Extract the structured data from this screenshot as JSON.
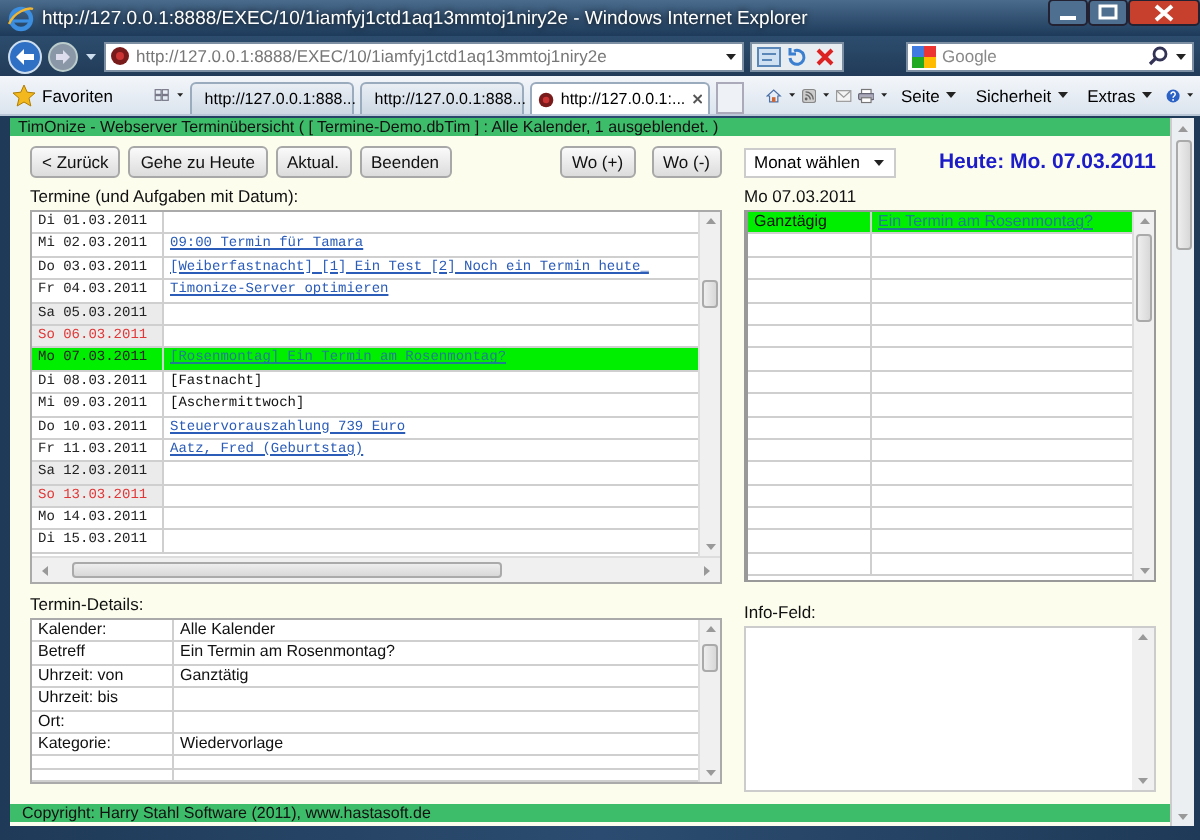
{
  "browser": {
    "title": "http://127.0.0.1:8888/EXEC/10/1iamfyj1ctd1aq13mmtoj1niry2e - Windows Internet Explorer",
    "address": "http://127.0.0.1:8888/EXEC/10/1iamfyj1ctd1aq13mmtoj1niry2e",
    "search_placeholder": "Google",
    "tabs": [
      {
        "label": "http://127.0.0.1:888...",
        "selected": false
      },
      {
        "label": "http://127.0.0.1:888...",
        "selected": false
      },
      {
        "label": "http://127.0.0.1:...",
        "selected": true
      }
    ],
    "favorites": "Favoriten",
    "menus": [
      "Seite",
      "Sicherheit",
      "Extras"
    ]
  },
  "app": {
    "header": "TimOnize - Webserver Terminübersicht ( [ Termine-Demo.dbTim ] : Alle Kalender, 1 ausgeblendet. )",
    "nav_buttons": [
      "< Zurück",
      "Gehe zu Heute",
      "Aktual.",
      "Beenden"
    ],
    "week_buttons": [
      "Wo (+)",
      "Wo (-)"
    ],
    "month_select": "Monat wählen",
    "today": "Heute: Mo. 07.03.2011",
    "list_label": "Termine (und Aufgaben mit Datum):",
    "list": {
      "rows": [
        {
          "date": "Di 01.03.2011",
          "kind": "weekday",
          "selected": false
        },
        {
          "date": "Mi 02.03.2011",
          "kind": "weekday",
          "text": "09:00 Termin für Tamara",
          "link": true,
          "selected": false
        },
        {
          "date": "Do 03.03.2011",
          "kind": "weekday",
          "text": "[Weiberfastnacht] [1] Ein Test [2] Noch ein Termin heute_",
          "link": true,
          "selected": false
        },
        {
          "date": "Fr 04.03.2011",
          "kind": "weekday",
          "text": "Timonize-Server optimieren",
          "link": true,
          "selected": false
        },
        {
          "date": "Sa 05.03.2011",
          "kind": "saturday",
          "selected": false
        },
        {
          "date": "So 06.03.2011",
          "kind": "sunday",
          "selected": false
        },
        {
          "date": "Mo 07.03.2011",
          "kind": "weekday",
          "text": "[Rosenmontag] Ein Termin am Rosenmontag?",
          "link": true,
          "selected": true
        },
        {
          "date": "Di 08.03.2011",
          "kind": "weekday",
          "text": "[Fastnacht]",
          "link": false,
          "selected": false
        },
        {
          "date": "Mi 09.03.2011",
          "kind": "weekday",
          "text": "[Aschermittwoch]",
          "link": false,
          "selected": false
        },
        {
          "date": "Do 10.03.2011",
          "kind": "weekday",
          "text": "Steuervorauszahlung 739 Euro",
          "link": true,
          "selected": false
        },
        {
          "date": "Fr 11.03.2011",
          "kind": "weekday",
          "text": "Aatz, Fred (Geburtstag)",
          "link": true,
          "selected": false
        },
        {
          "date": "Sa 12.03.2011",
          "kind": "saturday",
          "selected": false
        },
        {
          "date": "So 13.03.2011",
          "kind": "sunday",
          "selected": false
        },
        {
          "date": "Mo 14.03.2011",
          "kind": "weekday",
          "selected": false
        },
        {
          "date": "Di 15.03.2011",
          "kind": "weekday",
          "selected": false
        }
      ]
    },
    "day_label": "Mo 07.03.2011",
    "day": {
      "rows": [
        {
          "time": "Ganztägig",
          "text": "Ein Termin am Rosenmontag?",
          "selected": true
        }
      ]
    },
    "details_label": "Termin-Details:",
    "details": [
      {
        "label": "Kalender:",
        "value": "Alle Kalender"
      },
      {
        "label": "Betreff",
        "value": "Ein Termin am Rosenmontag?"
      },
      {
        "label": "Uhrzeit: von",
        "value": "Ganztätig"
      },
      {
        "label": "Uhrzeit: bis"
      },
      {
        "label": "Ort:"
      },
      {
        "label": "Kategorie:",
        "value": "Wiedervorlage"
      }
    ],
    "info_label": "Info-Feld:",
    "footer": "Copyright: Harry Stahl Software (2011), www.hastasoft.de"
  }
}
